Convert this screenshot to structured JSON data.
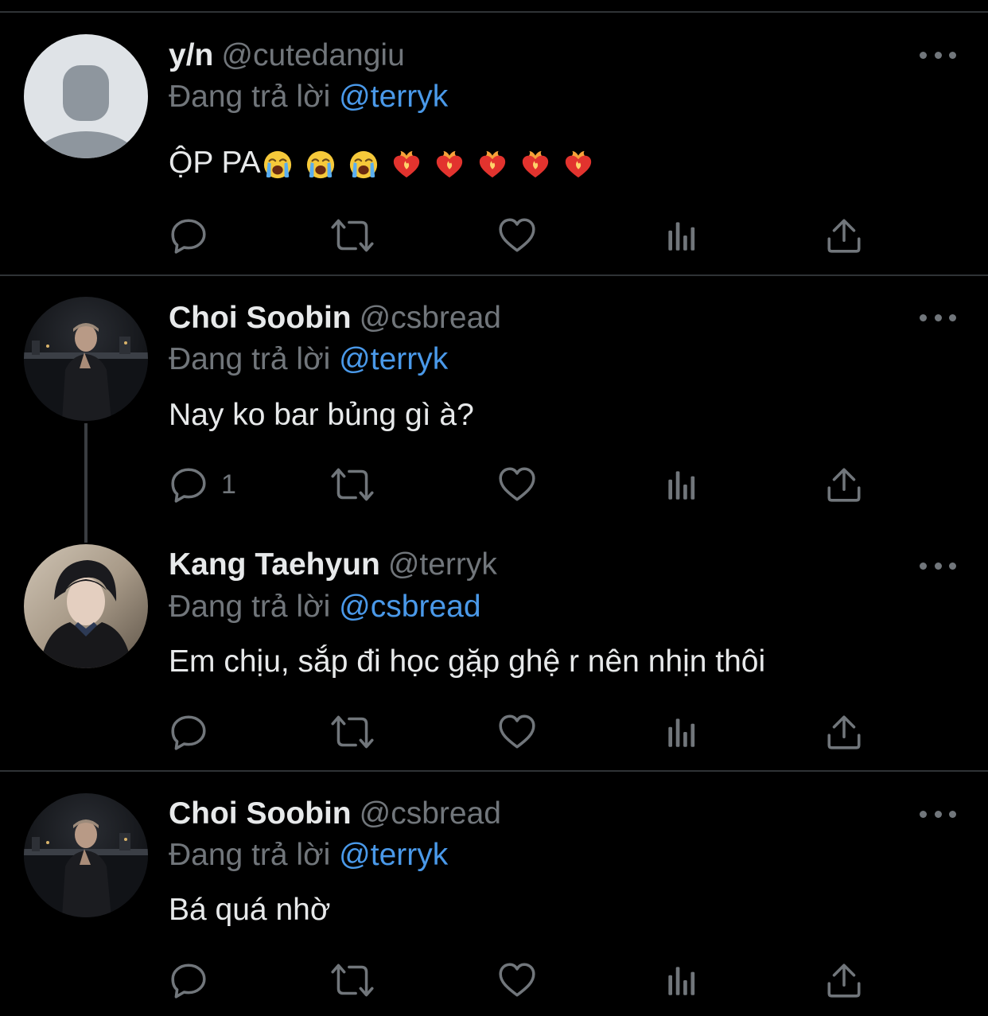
{
  "colors": {
    "background": "#000000",
    "divider": "#2f3336",
    "primary_text": "#e7e9ea",
    "secondary_text": "#71767b",
    "mention": "#4a99e9"
  },
  "tweets": [
    {
      "display_name": "y/n",
      "handle": "@cutedangiu",
      "reply_prefix": "Đang trả lời",
      "reply_to": "@terryk",
      "text": "ỘP PA",
      "emojis": [
        "loudly-crying-face",
        "loudly-crying-face",
        "loudly-crying-face",
        "heart-on-fire",
        "heart-on-fire",
        "heart-on-fire",
        "heart-on-fire",
        "heart-on-fire"
      ],
      "reply_count": "",
      "avatar": "default-profile-icon"
    },
    {
      "display_name": "Choi Soobin",
      "handle": "@csbread",
      "reply_prefix": "Đang trả lời",
      "reply_to": "@terryk",
      "text": "Nay ko bar bủng gì à?",
      "reply_count": "1",
      "avatar": "night-city-portrait-photo"
    },
    {
      "display_name": "Kang Taehyun",
      "handle": "@terryk",
      "reply_prefix": "Đang trả lời",
      "reply_to": "@csbread",
      "text": "Em chịu, sắp đi học gặp ghệ r nên nhịn thôi",
      "reply_count": "",
      "avatar": "portrait-photo"
    },
    {
      "display_name": "Choi Soobin",
      "handle": "@csbread",
      "reply_prefix": "Đang trả lời",
      "reply_to": "@terryk",
      "text": "Bá quá nhờ",
      "reply_count": "",
      "avatar": "night-city-portrait-photo"
    }
  ],
  "actions": [
    "reply-icon",
    "retweet-icon",
    "like-icon",
    "analytics-icon",
    "share-icon"
  ]
}
